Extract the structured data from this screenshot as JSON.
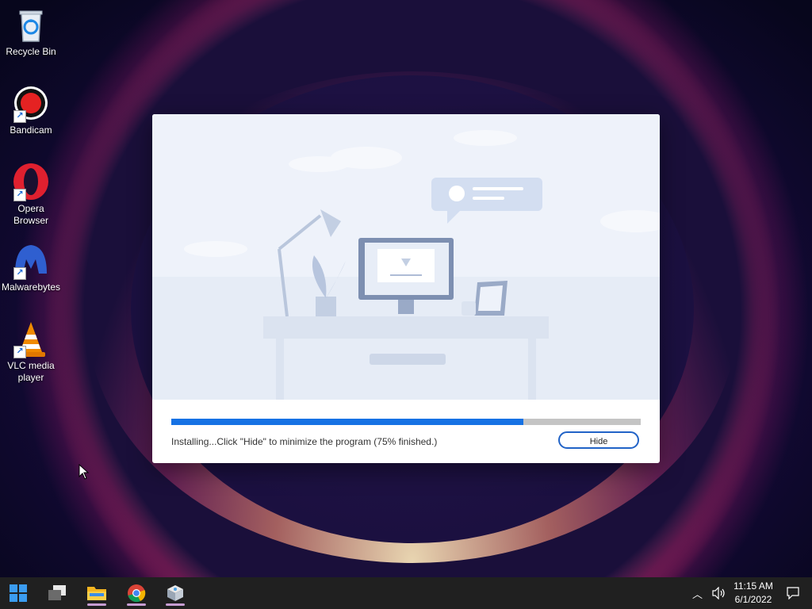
{
  "desktop": {
    "icons": [
      {
        "label": "Recycle Bin",
        "icon": "recycle-bin-icon"
      },
      {
        "label": "Bandicam",
        "icon": "bandicam-icon"
      },
      {
        "label": "Opera Browser",
        "icon": "opera-icon"
      },
      {
        "label": "Malwarebytes",
        "icon": "malwarebytes-icon"
      },
      {
        "label": "VLC media player",
        "icon": "vlc-icon"
      }
    ]
  },
  "installer": {
    "progress_fraction": 0.75,
    "status_text": "Installing...Click \"Hide\" to minimize the program (75% finished.)",
    "hide_label": "Hide",
    "accent": "#1672e4"
  },
  "taskbar": {
    "items": [
      {
        "name": "start",
        "icon": "windows-start-icon"
      },
      {
        "name": "task-view",
        "icon": "task-view-icon"
      },
      {
        "name": "file-explorer",
        "icon": "folder-icon"
      },
      {
        "name": "chrome",
        "icon": "chrome-icon"
      },
      {
        "name": "installer",
        "icon": "installer-app-icon"
      }
    ],
    "time": "11:15 AM",
    "date": "6/1/2022"
  }
}
